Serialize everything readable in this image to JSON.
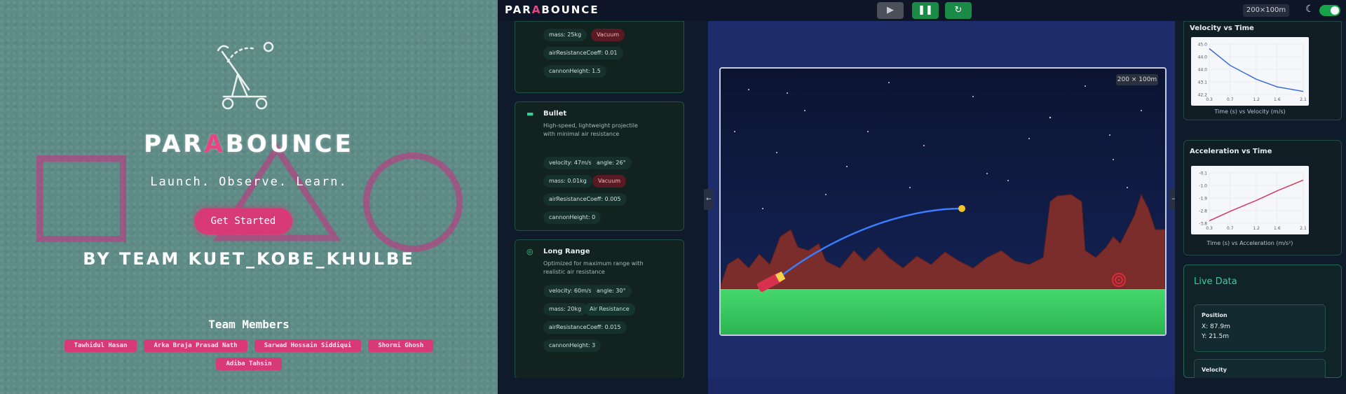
{
  "landing": {
    "brand_a": "PAR",
    "brand_b": "A",
    "brand_c": "BOUNCE",
    "tagline": "Launch. Observe. Learn.",
    "cta": "Get Started",
    "team_line": "BY TEAM KUET_KOBE_KHULBE",
    "members_title": "Team Members",
    "members": [
      "Tawhidul Hasan",
      "Arka Braja Prasad Nath",
      "Sarwad Hossain Siddiqui",
      "Shormi Ghosh",
      "Adiba Tahsin"
    ],
    "accent_color": "#d83a78"
  },
  "app": {
    "logo_a": "PAR",
    "logo_b": "A",
    "logo_c": "BOUNCE",
    "controls": {
      "play_icon": "play-icon",
      "pause_icon": "pause-icon",
      "reset_icon": "reset-icon"
    },
    "world_size": "200×100m",
    "theme_icon": "moon-icon",
    "sim_badge": "200 × 100m"
  },
  "presets": [
    {
      "name": "",
      "pills": [
        "mass: 25kg",
        "Vacuum",
        "airResistanceCoeff: 0.01",
        "cannonHeight: 1.5"
      ]
    },
    {
      "name": "Bullet",
      "icon": "dash-icon",
      "description": "High-speed, lightweight projectile with minimal air resistance",
      "pills": [
        "velocity: 47m/s",
        "angle: 26°",
        "mass: 0.01kg",
        "Vacuum",
        "airResistanceCoeff: 0.005",
        "cannonHeight: 0"
      ]
    },
    {
      "name": "Long Range",
      "icon": "target-icon",
      "description": "Optimized for maximum range with realistic air resistance",
      "pills": [
        "velocity: 60m/s",
        "angle: 30°",
        "mass: 20kg",
        "Air Resistance",
        "airResistanceCoeff: 0.015",
        "cannonHeight: 3"
      ]
    }
  ],
  "charts": {
    "velocity": {
      "title": "Velocity vs Time",
      "caption": "Time (s) vs Velocity (m/s)",
      "color": "#3b6fd8"
    },
    "acceleration": {
      "title": "Acceleration vs Time",
      "caption": "Time (s) vs Acceleration (m/s²)",
      "color": "#d23b5c"
    }
  },
  "chart_data": [
    {
      "type": "line",
      "title": "Velocity vs Time",
      "xlabel": "Time (s) vs Velocity (m/s)",
      "x_ticks": [
        "0.3",
        "0.7",
        "1.2",
        "1.6",
        "2.1"
      ],
      "y_ticks": [
        "45.0",
        "44.0",
        "44.0",
        "43.1",
        "42.2"
      ],
      "x": [
        0.3,
        0.7,
        1.2,
        1.6,
        2.1
      ],
      "series": [
        {
          "values": [
            45.0,
            43.9,
            43.0,
            42.5,
            42.2
          ]
        }
      ],
      "ylim": [
        42.0,
        45.3
      ]
    },
    {
      "type": "line",
      "title": "Acceleration vs Time",
      "xlabel": "Time (s) vs Acceleration (m/s²)",
      "x_ticks": [
        "0.3",
        "0.7",
        "1.2",
        "1.6",
        "2.1"
      ],
      "y_ticks": [
        "-0.1",
        "-1.0",
        "-1.9",
        "-2.8",
        "-3.8"
      ],
      "x": [
        0.3,
        0.7,
        1.2,
        1.6,
        2.1
      ],
      "series": [
        {
          "values": [
            -3.8,
            -3.0,
            -2.1,
            -1.3,
            -0.4
          ]
        }
      ],
      "ylim": [
        -4.0,
        0.2
      ]
    }
  ],
  "live": {
    "title": "Live Data",
    "position_label": "Position",
    "x": "X: 87.9m",
    "y": "Y: 21.5m",
    "velocity_label": "Velocity"
  }
}
